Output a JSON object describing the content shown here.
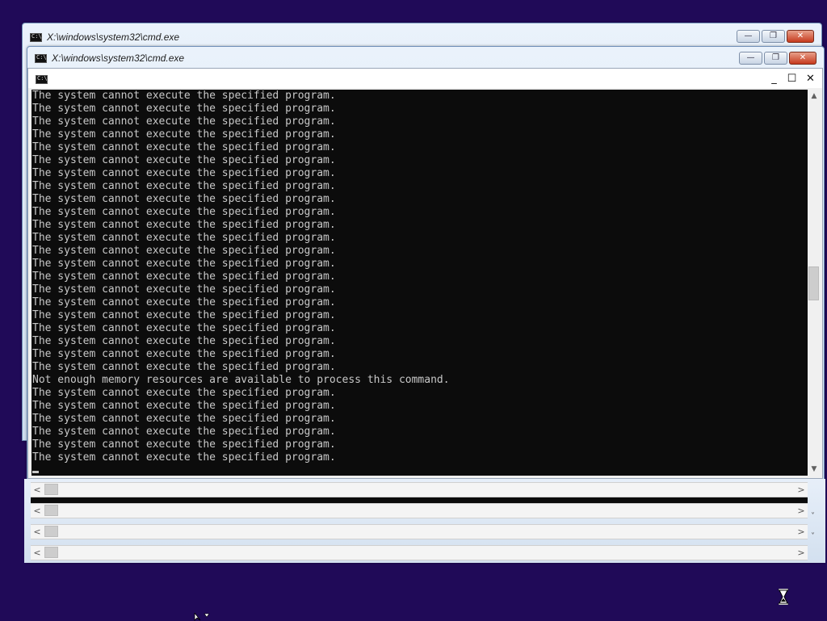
{
  "windows": {
    "back1": {
      "title": "X:\\windows\\system32\\cmd.exe",
      "minimize": "—",
      "restore": "❐",
      "close": "✕"
    },
    "back2": {
      "title": "X:\\windows\\system32\\cmd.exe",
      "minimize": "—",
      "restore": "❐",
      "close": "✕"
    },
    "front": {
      "minimize": "_",
      "maximize": "☐",
      "close": "✕"
    }
  },
  "console": {
    "lines": [
      "The system cannot execute the specified program.",
      "The system cannot execute the specified program.",
      "The system cannot execute the specified program.",
      "The system cannot execute the specified program.",
      "The system cannot execute the specified program.",
      "The system cannot execute the specified program.",
      "The system cannot execute the specified program.",
      "The system cannot execute the specified program.",
      "The system cannot execute the specified program.",
      "The system cannot execute the specified program.",
      "The system cannot execute the specified program.",
      "The system cannot execute the specified program.",
      "The system cannot execute the specified program.",
      "The system cannot execute the specified program.",
      "The system cannot execute the specified program.",
      "The system cannot execute the specified program.",
      "The system cannot execute the specified program.",
      "The system cannot execute the specified program.",
      "The system cannot execute the specified program.",
      "The system cannot execute the specified program.",
      "The system cannot execute the specified program.",
      "The system cannot execute the specified program.",
      "Not enough memory resources are available to process this command.",
      "The system cannot execute the specified program.",
      "The system cannot execute the specified program.",
      "The system cannot execute the specified program.",
      "The system cannot execute the specified program.",
      "The system cannot execute the specified program.",
      "The system cannot execute the specified program."
    ]
  },
  "scrollbars": {
    "up": "▲",
    "down": "▼",
    "left": "<",
    "right": ">",
    "side_down": "˅"
  },
  "colors": {
    "desktop": "#200a58",
    "console_bg": "#0c0c0c",
    "console_text": "#c8c8c8"
  },
  "icons": {
    "busy_cursor": "hourglass-icon",
    "pointer_cursor": "pointer-icon"
  }
}
